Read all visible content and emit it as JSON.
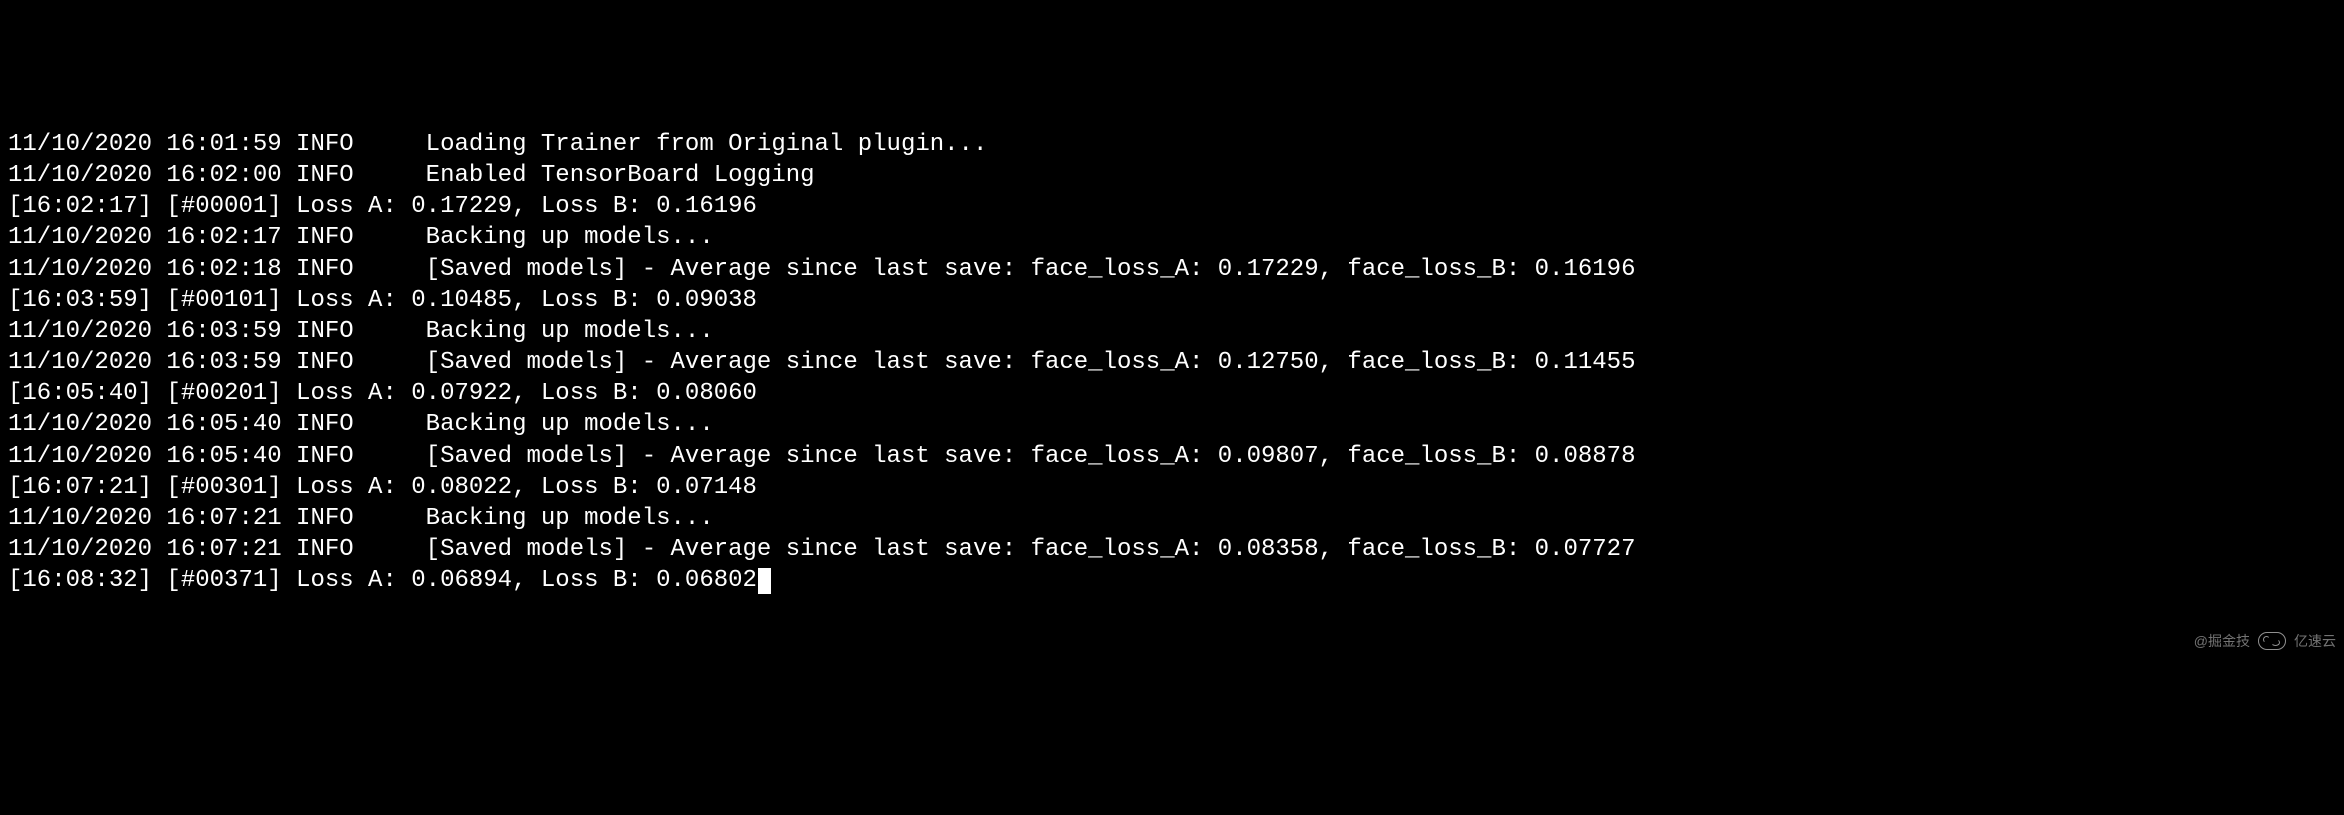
{
  "terminal": {
    "lines": [
      "11/10/2020 16:01:59 INFO     Loading Trainer from Original plugin...",
      "11/10/2020 16:02:00 INFO     Enabled TensorBoard Logging",
      "[16:02:17] [#00001] Loss A: 0.17229, Loss B: 0.16196",
      "11/10/2020 16:02:17 INFO     Backing up models...",
      "11/10/2020 16:02:18 INFO     [Saved models] - Average since last save: face_loss_A: 0.17229, face_loss_B: 0.16196",
      "[16:03:59] [#00101] Loss A: 0.10485, Loss B: 0.09038",
      "11/10/2020 16:03:59 INFO     Backing up models...",
      "11/10/2020 16:03:59 INFO     [Saved models] - Average since last save: face_loss_A: 0.12750, face_loss_B: 0.11455",
      "[16:05:40] [#00201] Loss A: 0.07922, Loss B: 0.08060",
      "11/10/2020 16:05:40 INFO     Backing up models...",
      "11/10/2020 16:05:40 INFO     [Saved models] - Average since last save: face_loss_A: 0.09807, face_loss_B: 0.08878",
      "[16:07:21] [#00301] Loss A: 0.08022, Loss B: 0.07148",
      "11/10/2020 16:07:21 INFO     Backing up models...",
      "11/10/2020 16:07:21 INFO     [Saved models] - Average since last save: face_loss_A: 0.08358, face_loss_B: 0.07727",
      "[16:08:32] [#00371] Loss A: 0.06894, Loss B: 0.06802"
    ]
  },
  "watermark": {
    "text1": "@掘金技",
    "text2": "亿速云"
  }
}
